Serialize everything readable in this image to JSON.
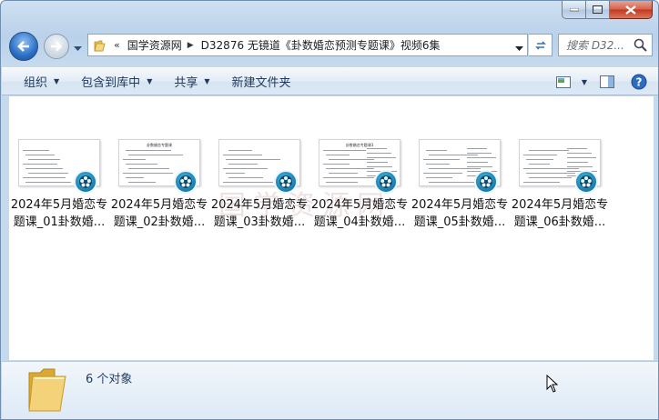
{
  "window": {
    "caption_buttons": [
      "minimize",
      "maximize",
      "close"
    ]
  },
  "address_bar": {
    "overflow_chevron": "«",
    "segments": [
      "国学资源网",
      "D32876 无镜道《卦数婚恋预测专题课》视频6集"
    ]
  },
  "search": {
    "placeholder": "搜索 D32..."
  },
  "toolbar": {
    "organize": "组织",
    "include_in_library": "包含到库中",
    "share": "共享",
    "new_folder": "新建文件夹"
  },
  "files": [
    {
      "line1": "2024年5月婚恋专",
      "line2": "题课_01卦数婚...",
      "thumb_title": ""
    },
    {
      "line1": "2024年5月婚恋专",
      "line2": "题课_02卦数婚...",
      "thumb_title": "卦数婚恋专题课"
    },
    {
      "line1": "2024年5月婚恋专",
      "line2": "题课_03卦数婚...",
      "thumb_title": ""
    },
    {
      "line1": "2024年5月婚恋专",
      "line2": "题课_04卦数婚...",
      "thumb_title": "卦数婚恋专题课3"
    },
    {
      "line1": "2024年5月婚恋专",
      "line2": "题课_05卦数婚...",
      "thumb_title": ""
    },
    {
      "line1": "2024年5月婚恋专",
      "line2": "题课_06卦数婚...",
      "thumb_title": ""
    }
  ],
  "watermark": "国学资源网",
  "status": {
    "item_count": "6 个对象"
  },
  "colors": {
    "frame": "#b9d1ea",
    "toolbar_text": "#1e395b",
    "badge": "#1a7fb0"
  }
}
